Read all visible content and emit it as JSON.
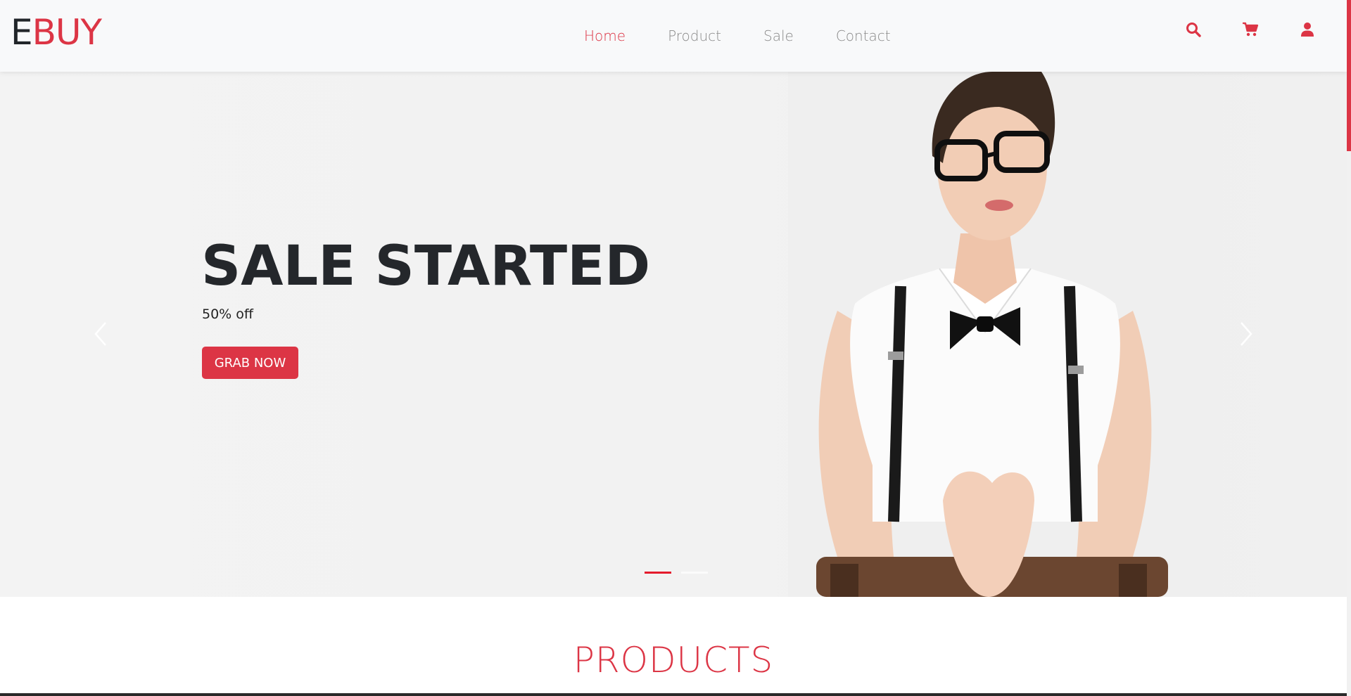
{
  "brand": {
    "first": "E",
    "rest": "BUY"
  },
  "nav": {
    "links": [
      {
        "label": "Home",
        "active": true
      },
      {
        "label": "Product",
        "active": false
      },
      {
        "label": "Sale",
        "active": false
      },
      {
        "label": "Contact",
        "active": false
      }
    ],
    "icons": [
      "search-icon",
      "cart-icon",
      "user-icon"
    ]
  },
  "hero": {
    "title": "SALE STARTED",
    "subtitle": "50% off",
    "button": "GRAB NOW",
    "slides": 2,
    "active_slide": 1
  },
  "products": {
    "heading": "PRODUCTS"
  },
  "colors": {
    "accent": "#dc3545",
    "text": "#212529",
    "nav_muted": "#8a8a8a",
    "header_bg": "#f8f9fa"
  }
}
